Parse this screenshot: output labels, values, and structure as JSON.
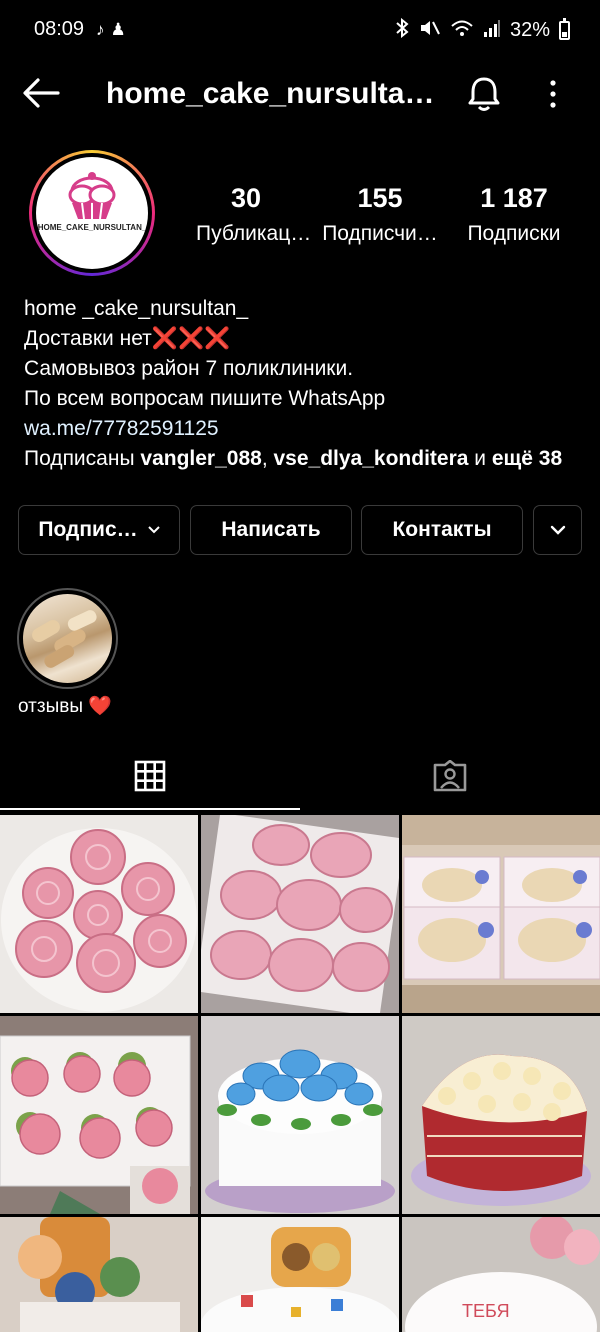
{
  "status_bar": {
    "time": "08:09",
    "battery": "32%"
  },
  "header": {
    "username": "home_cake_nursultan_"
  },
  "profile": {
    "avatar_text": "HOME_CAKE_NURSULTAN_",
    "stats": [
      {
        "value": "30",
        "label": "Публикац…"
      },
      {
        "value": "155",
        "label": "Подписчи…"
      },
      {
        "value": "1 187",
        "label": "Подписки"
      }
    ]
  },
  "bio": {
    "name": "home _cake_nursultan_",
    "line1": "Доставки нет",
    "line1_emoji": "❌❌❌",
    "line2": "Самовывоз район 7 поликлиники.",
    "line3": "По всем вопросам пишите WhatsApp",
    "link": "wa.me/77782591125",
    "followed_prefix": "Подписаны",
    "followed_user1": "vangler_088",
    "followed_sep": ",",
    "followed_user2": "vse_dlya_konditera",
    "followed_and": "и",
    "followed_more": "ещё 38"
  },
  "buttons": {
    "subscribed": "Подпис…",
    "message": "Написать",
    "contacts": "Контакты"
  },
  "highlights": [
    {
      "label": "отзывы",
      "emoji": "❤️"
    }
  ],
  "colors": {
    "background": "#000000",
    "button_border": "#3a3a3a",
    "link": "#e0f1ff",
    "red_x": "#e22c3f"
  }
}
